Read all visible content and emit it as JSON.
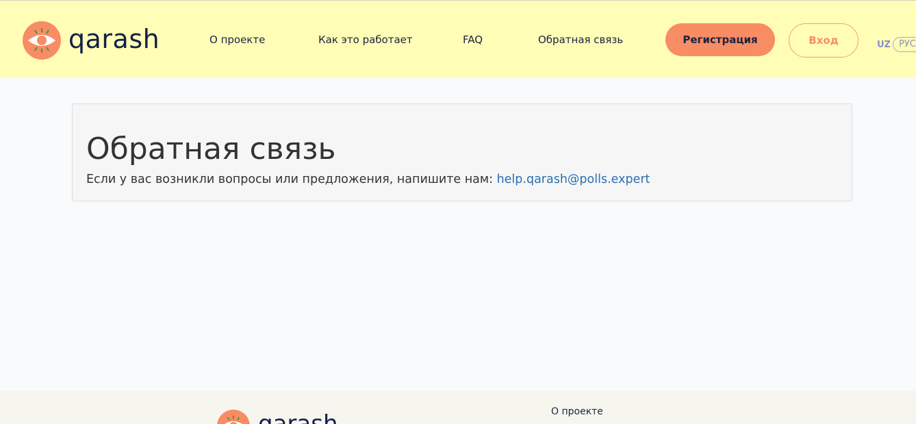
{
  "header": {
    "logo_text": "qarash",
    "nav": [
      {
        "label": "О проекте"
      },
      {
        "label": "Как это работает"
      },
      {
        "label": "FAQ"
      },
      {
        "label": "Обратная связь"
      }
    ],
    "register_label": "Регистрация",
    "login_label": "Вход",
    "lang_uz": "UZ",
    "lang_ru": "РУС"
  },
  "panel": {
    "title": "Обратная связь",
    "text": "Если у вас возникли вопросы или предложения, напишите нам: ",
    "email": "help.qarash@polls.expert"
  },
  "footer": {
    "logo_text": "qarash",
    "link_about": "О проекте"
  },
  "colors": {
    "header_bg": "#fffdb6",
    "accent": "#f88c64",
    "brand_dark": "#12204a",
    "link": "#2a6eb4"
  }
}
